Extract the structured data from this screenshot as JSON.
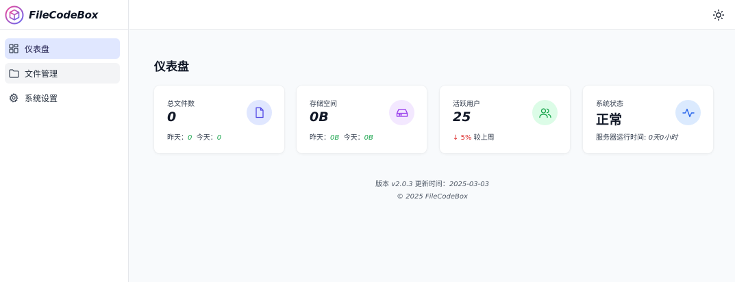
{
  "brand": {
    "name": "FileCodeBox"
  },
  "sidebar": {
    "items": [
      {
        "label": "仪表盘",
        "icon": "dashboard-grid-icon"
      },
      {
        "label": "文件管理",
        "icon": "folder-icon"
      },
      {
        "label": "系统设置",
        "icon": "gear-icon"
      }
    ]
  },
  "header": {
    "theme_icon": "sun-icon"
  },
  "page": {
    "title": "仪表盘"
  },
  "cards": [
    {
      "label": "总文件数",
      "value": "0",
      "icon": "file-icon",
      "foot": {
        "yesterday_label": "昨天：",
        "yesterday_value": "0",
        "today_label": "今天：",
        "today_value": "0"
      }
    },
    {
      "label": "存储空间",
      "value": "0B",
      "icon": "hard-drive-icon",
      "foot": {
        "yesterday_label": "昨天：",
        "yesterday_value": "0B",
        "today_label": "今天：",
        "today_value": "0B"
      }
    },
    {
      "label": "活跃用户",
      "value": "25",
      "icon": "users-icon",
      "foot": {
        "arrow": "↓",
        "change": "5%",
        "suffix": "较上周"
      }
    },
    {
      "label": "系统状态",
      "value": "正常",
      "icon": "activity-icon",
      "foot": {
        "uptime_label": "服务器运行时间: ",
        "uptime_value": "0天0小时"
      }
    }
  ],
  "footer": {
    "version_label": "版本 ",
    "version": "v2.0.3",
    "updated_label": " 更新时间：",
    "updated": "2025-03-03",
    "copyright": "© 2025 FileCodeBox"
  },
  "colors": {
    "accent": "#6366f1",
    "file_icon_bg": "#e0e7ff",
    "storage_icon_bg": "#f3e8ff",
    "users_icon_bg": "#dcfce7",
    "status_icon_bg": "#dbeafe",
    "positive": "#16a34a",
    "negative": "#dc2626"
  }
}
